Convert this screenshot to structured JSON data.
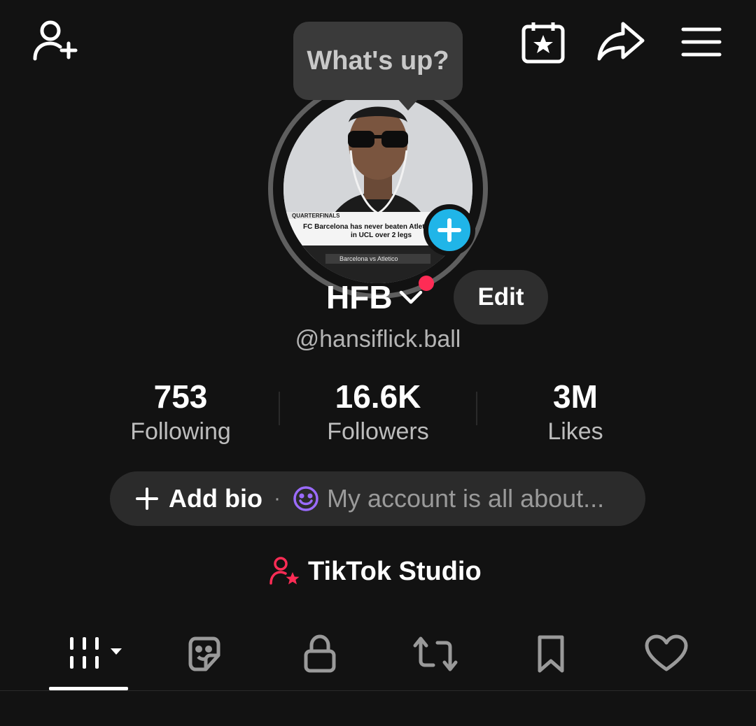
{
  "header": {
    "add_friend_icon": "person-plus-icon",
    "calendar_icon": "calendar-star-icon",
    "share_icon": "share-arrow-icon",
    "menu_icon": "hamburger-menu-icon"
  },
  "profile": {
    "tooltip_text": "What's up?",
    "avatar_add_icon": "plus-icon",
    "display_name": "HFB",
    "edit_label": "Edit",
    "username": "@hansiflick.ball"
  },
  "stats": [
    {
      "value": "753",
      "label": "Following"
    },
    {
      "value": "16.6K",
      "label": "Followers"
    },
    {
      "value": "3M",
      "label": "Likes"
    }
  ],
  "bio": {
    "add_label": "Add bio",
    "separator": "·",
    "placeholder": "My account is all about..."
  },
  "studio": {
    "label": "TikTok Studio"
  },
  "tabs": [
    {
      "name": "videos-grid-icon",
      "active": true
    },
    {
      "name": "stickers-icon",
      "active": false
    },
    {
      "name": "private-lock-icon",
      "active": false
    },
    {
      "name": "reposts-icon",
      "active": false
    },
    {
      "name": "favorites-bookmark-icon",
      "active": false
    },
    {
      "name": "liked-heart-icon",
      "active": false
    }
  ],
  "colors": {
    "background": "#121212",
    "accent_blue": "#20b5e8",
    "accent_red": "#fe2c55",
    "smile_purple": "#9b6bff"
  }
}
